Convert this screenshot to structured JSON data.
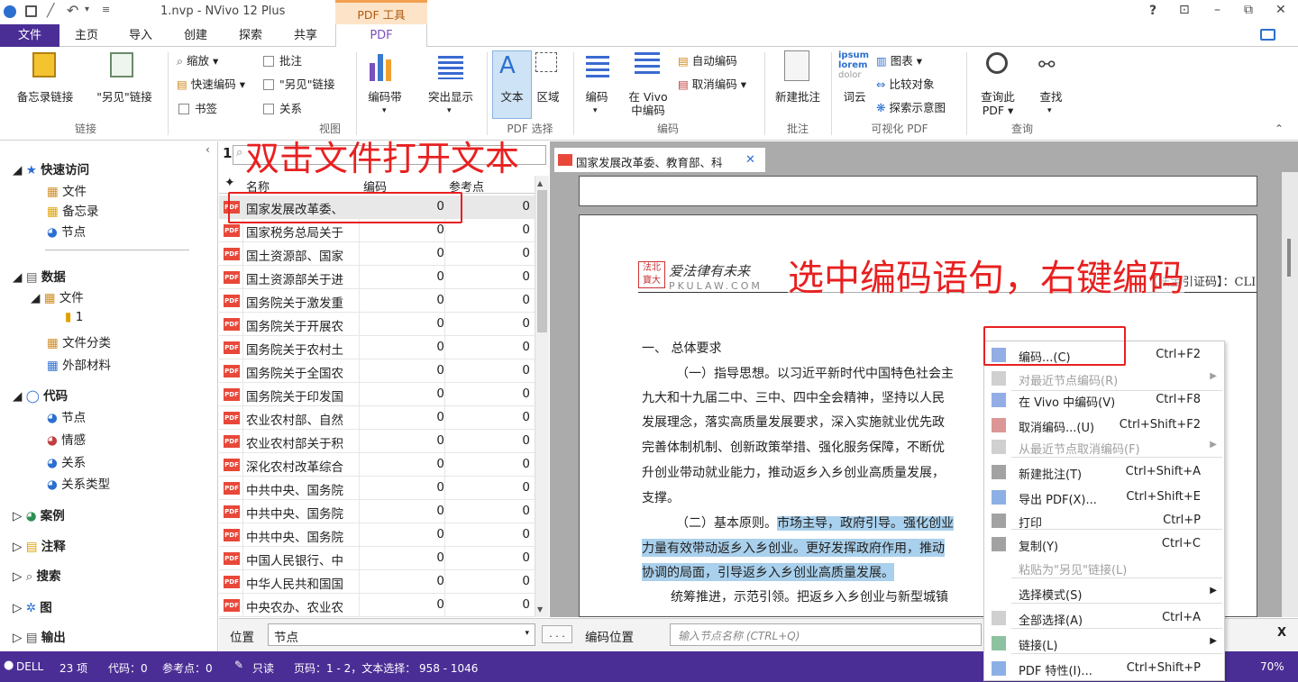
{
  "titlebar": {
    "title": "1.nvp - NVivo 12 Plus",
    "tool_tab": "PDF 工具",
    "help": "?",
    "restore": "⊡",
    "min": "–",
    "max": "⧉",
    "close": "✕"
  },
  "tabs": [
    "文件",
    "主页",
    "导入",
    "创建",
    "探索",
    "共享",
    "PDF"
  ],
  "ribbon": {
    "memo_link": "备忘录链接",
    "seealso_link": "\"另见\"链接",
    "group_link": "链接",
    "zoom": "缩放",
    "quick_code": "快速编码",
    "bookmark": "书签",
    "annotation": "批注",
    "seealso2": "\"另见\"链接",
    "relation": "关系",
    "group_view": "视图",
    "code_strip": "编码带",
    "highlight": "突出显示",
    "text": "文本",
    "region": "区域",
    "group_pdfsel": "PDF 选择",
    "code": "编码",
    "code_in_vivo": "在 Vivo",
    "code_in_vivo2": "中编码",
    "auto_code": "自动编码",
    "uncode": "取消编码",
    "group_code": "编码",
    "new_annotation": "新建批注",
    "group_annotation": "批注",
    "wordcloud": "词云",
    "chart": "图表",
    "compare": "比较对象",
    "explore_diagram": "探索示意图",
    "group_visualize": "可视化 PDF",
    "query_pdf": "查询此",
    "query_pdf2": "PDF",
    "find": "查找",
    "group_query": "查询"
  },
  "nav": {
    "quick_access": "快速访问",
    "files": "文件",
    "memos": "备忘录",
    "nodes": "节点",
    "data": "数据",
    "data_files": "文件",
    "folder1": "1",
    "file_class": "文件分类",
    "external": "外部材料",
    "codes": "代码",
    "code_nodes": "节点",
    "sentiment": "情感",
    "relations": "关系",
    "relation_types": "关系类型",
    "cases": "案例",
    "notes": "注释",
    "search": "搜索",
    "maps": "图",
    "output": "输出"
  },
  "list": {
    "search_num": "1",
    "headers": {
      "name": "名称",
      "codes": "编码",
      "refs": "参考点"
    },
    "rows": [
      {
        "name": "国家发展改革委、",
        "codes": "0",
        "refs": "0"
      },
      {
        "name": "国家税务总局关于",
        "codes": "0",
        "refs": "0"
      },
      {
        "name": "国土资源部、国家",
        "codes": "0",
        "refs": "0"
      },
      {
        "name": "国土资源部关于进",
        "codes": "0",
        "refs": "0"
      },
      {
        "name": "国务院关于激发重",
        "codes": "0",
        "refs": "0"
      },
      {
        "name": "国务院关于开展农",
        "codes": "0",
        "refs": "0"
      },
      {
        "name": "国务院关于农村土",
        "codes": "0",
        "refs": "0"
      },
      {
        "name": "国务院关于全国农",
        "codes": "0",
        "refs": "0"
      },
      {
        "name": "国务院关于印发国",
        "codes": "0",
        "refs": "0"
      },
      {
        "name": "农业农村部、自然",
        "codes": "0",
        "refs": "0"
      },
      {
        "name": "农业农村部关于积",
        "codes": "0",
        "refs": "0"
      },
      {
        "name": "深化农村改革综合",
        "codes": "0",
        "refs": "0"
      },
      {
        "name": "中共中央、国务院",
        "codes": "0",
        "refs": "0"
      },
      {
        "name": "中共中央、国务院",
        "codes": "0",
        "refs": "0"
      },
      {
        "name": "中共中央、国务院",
        "codes": "0",
        "refs": "0"
      },
      {
        "name": "中国人民银行、中",
        "codes": "0",
        "refs": "0"
      },
      {
        "name": "中华人民共和国国",
        "codes": "0",
        "refs": "0"
      },
      {
        "name": "中央农办、农业农",
        "codes": "0",
        "refs": "0"
      }
    ]
  },
  "doc": {
    "tab_title": "国家发展改革委、教育部、科",
    "logo1": "法北",
    "logo2": "寶大",
    "brand": "爱法律有未来",
    "brand_en": "PKULAW.COM",
    "cite": "【法宝引证码】：CLI",
    "p1": "一、 总体要求",
    "p2": "（一）指导思想。以习近平新时代中国特色社会主",
    "p3": "九大和十九届二中、三中、四中全会精神，坚持以人民",
    "p4": "发展理念，落实高质量发展要求，深入实施就业优先政",
    "p5": "完善体制机制、创新政策举措、强化服务保障，不断优",
    "p6": "升创业带动就业能力，推动返乡入乡创业高质量发展，",
    "p7": "支撑。",
    "p8a": "（二）基本原则。",
    "p8b": "市场主导，政府引导。强化创业",
    "p9": "力量有效带动返乡入乡创业。更好发挥政府作用，推动",
    "p10": "协调的局面，引导返乡入乡创业高质量发展。",
    "p11": "统筹推进，示范引领。把返乡入乡创业与新型城镇"
  },
  "menu": [
    {
      "label": "编码...(C)",
      "shortcut": "Ctrl+F2",
      "disabled": false
    },
    {
      "label": "对最近节点编码(R)",
      "shortcut": "",
      "disabled": true
    },
    {
      "label": "在 Vivo 中编码(V)",
      "shortcut": "Ctrl+F8",
      "disabled": false
    },
    {
      "label": "取消编码...(U)",
      "shortcut": "Ctrl+Shift+F2",
      "disabled": false
    },
    {
      "label": "从最近节点取消编码(F)",
      "shortcut": "",
      "disabled": true
    },
    {
      "label": "新建批注(T)",
      "shortcut": "Ctrl+Shift+A",
      "disabled": false
    },
    {
      "label": "导出 PDF(X)...",
      "shortcut": "Ctrl+Shift+E",
      "disabled": false
    },
    {
      "label": "打印",
      "shortcut": "Ctrl+P",
      "disabled": false
    },
    {
      "label": "复制(Y)",
      "shortcut": "Ctrl+C",
      "disabled": false
    },
    {
      "label": "粘贴为\"另见\"链接(L)",
      "shortcut": "",
      "disabled": true
    },
    {
      "label": "选择模式(S)",
      "shortcut": "",
      "disabled": false
    },
    {
      "label": "全部选择(A)",
      "shortcut": "Ctrl+A",
      "disabled": false
    },
    {
      "label": "链接(L)",
      "shortcut": "",
      "disabled": false
    },
    {
      "label": "PDF 特性(I)...",
      "shortcut": "Ctrl+Shift+P",
      "disabled": false
    }
  ],
  "bottom": {
    "position": "位置",
    "node": "节点",
    "dots": ". . .",
    "code_position": "编码位置",
    "node_placeholder": "输入节点名称 (CTRL+Q)",
    "close": "X"
  },
  "status": {
    "user": "DELL",
    "items": "23 项",
    "codes": "代码：0",
    "refs": "参考点：0",
    "readonly": "只读",
    "pages": "页码：1 - 2，文本选择： 958 - 1046",
    "zoom": "70%"
  },
  "annotations": {
    "a1": "双击文件打开文本",
    "a2": "选中编码语句，右键编码"
  },
  "colors": {
    "accent": "#4b2e95",
    "annot": "#e82020",
    "highlight": "#a9d0ec"
  }
}
